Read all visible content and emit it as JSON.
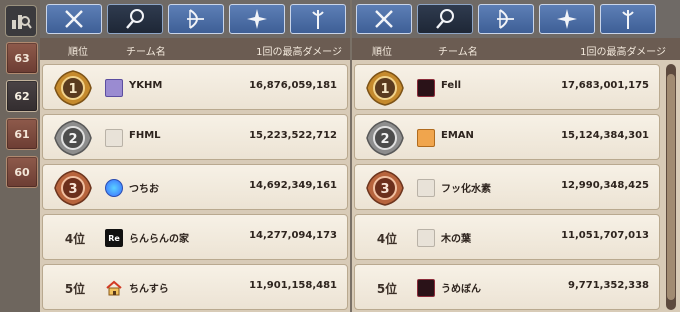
{
  "seasons": [
    "63",
    "62",
    "61",
    "60"
  ],
  "active_season": "62",
  "columns": {
    "rank": "順位",
    "team": "チーム名",
    "damage": "1回の最高ダメージ"
  },
  "left_board": {
    "rows": [
      {
        "rank": "1",
        "medal": "gold",
        "team": "YKHM",
        "icon": "avatar-icon",
        "damage": "16,876,059,181"
      },
      {
        "rank": "2",
        "medal": "silver",
        "team": "FHML",
        "icon": "placeholder-icon",
        "damage": "15,223,522,712"
      },
      {
        "rank": "3",
        "medal": "bronze",
        "team": "つちお",
        "icon": "globe-icon",
        "damage": "14,692,349,161"
      },
      {
        "rank": "4位",
        "medal": "",
        "team": "らんらんの家",
        "icon": "re-logo-icon",
        "damage": "14,277,094,173"
      },
      {
        "rank": "5位",
        "medal": "",
        "team": "ちんすら",
        "icon": "house-icon",
        "damage": "11,901,158,481"
      }
    ]
  },
  "right_board": {
    "rows": [
      {
        "rank": "1",
        "medal": "gold",
        "team": "Fell",
        "icon": "demon-icon",
        "damage": "17,683,001,175"
      },
      {
        "rank": "2",
        "medal": "silver",
        "team": "EMAN",
        "icon": "cat-icon",
        "damage": "15,124,384,301"
      },
      {
        "rank": "3",
        "medal": "bronze",
        "team": "フッ化水素",
        "icon": "placeholder-icon",
        "damage": "12,990,348,425"
      },
      {
        "rank": "4位",
        "medal": "",
        "team": "木の葉",
        "icon": "placeholder-icon",
        "damage": "11,051,707,013"
      },
      {
        "rank": "5位",
        "medal": "",
        "team": "うめぼん",
        "icon": "demon-icon",
        "damage": "9,771,352,338"
      }
    ]
  },
  "tabs": [
    "sword-icon",
    "wand-icon",
    "bow-icon",
    "cross-star-icon",
    "staff-icon"
  ],
  "active_tab": 1,
  "colors": {
    "gold": "#c58a2d",
    "silver": "#8d8d8d",
    "bronze": "#b7643d",
    "tab_blue": "#4a6ea8"
  }
}
